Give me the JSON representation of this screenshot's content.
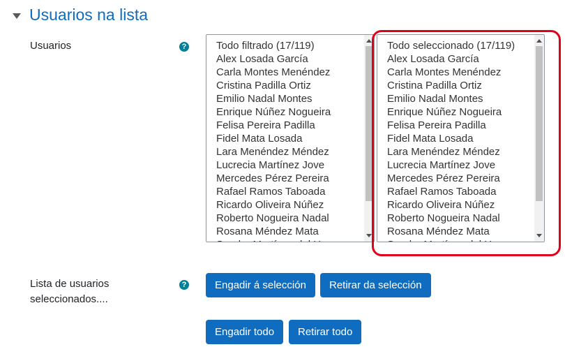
{
  "section": {
    "title": "Usuarios na lista"
  },
  "users_field": {
    "label": "Usuarios",
    "help_glyph": "?"
  },
  "left_list": {
    "items": [
      "Todo filtrado (17/119)",
      "Alex Losada García",
      "Carla Montes Menéndez",
      "Cristina Padilla Ortiz",
      "Emilio Nadal Montes",
      "Enrique Núñez Nogueira",
      "Felisa Pereira Padilla",
      "Fidel Mata Losada",
      "Lara Menéndez Méndez",
      "Lucrecia Martínez Jove",
      "Mercedes Pérez Pereira",
      "Rafael Ramos Taboada",
      "Ricardo Oliveira Núñez",
      "Roberto Nogueira Nadal",
      "Rosana Méndez Mata",
      "Sandra Martínez del Herrero"
    ]
  },
  "right_list": {
    "items": [
      "Todo seleccionado (17/119)",
      "Alex Losada García",
      "Carla Montes Menéndez",
      "Cristina Padilla Ortiz",
      "Emilio Nadal Montes",
      "Enrique Núñez Nogueira",
      "Felisa Pereira Padilla",
      "Fidel Mata Losada",
      "Lara Menéndez Méndez",
      "Lucrecia Martínez Jove",
      "Mercedes Pérez Pereira",
      "Rafael Ramos Taboada",
      "Ricardo Oliveira Núñez",
      "Roberto Nogueira Nadal",
      "Rosana Méndez Mata",
      "Sandra Martínez del Herrero"
    ]
  },
  "selected_field": {
    "label": "Lista de usuarios seleccionados....",
    "help_glyph": "?"
  },
  "buttons": {
    "add_selection": "Engadir á selección",
    "remove_selection": "Retirar da selección",
    "add_all": "Engadir todo",
    "remove_all": "Retirar todo"
  },
  "colors": {
    "primary": "#0f6cbf",
    "help": "#008196",
    "highlight": "#e0001b"
  }
}
